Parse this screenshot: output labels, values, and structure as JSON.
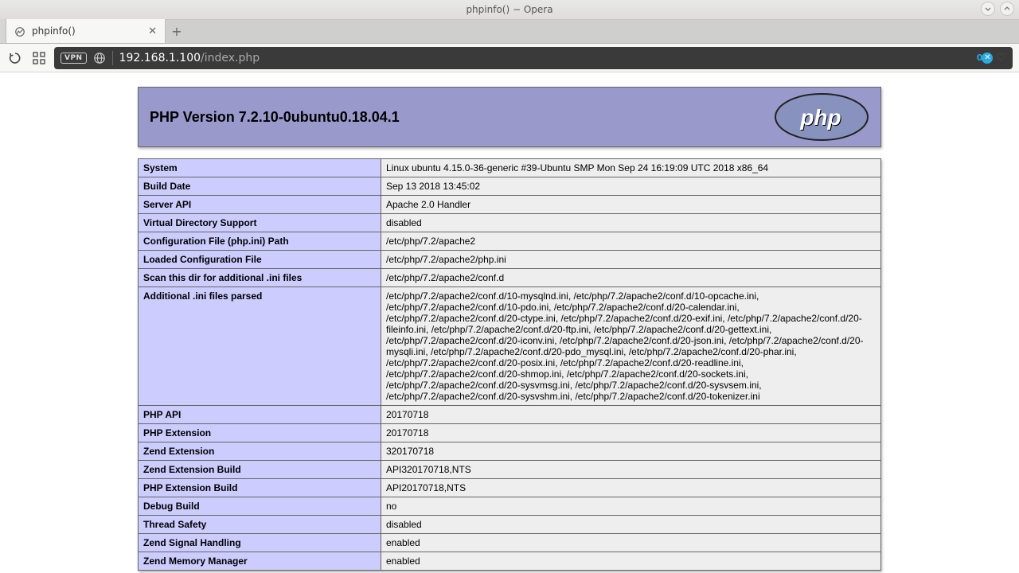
{
  "window": {
    "title": "phpinfo() − Opera"
  },
  "tab": {
    "label": "phpinfo()"
  },
  "address": {
    "vpn": "VPN",
    "host": "192.168.1.100",
    "path": "/index.php",
    "adblock_count": "0"
  },
  "php": {
    "header": "PHP Version 7.2.10-0ubuntu0.18.04.1"
  },
  "rows": [
    {
      "k": "System",
      "v": "Linux ubuntu 4.15.0-36-generic #39-Ubuntu SMP Mon Sep 24 16:19:09 UTC 2018 x86_64"
    },
    {
      "k": "Build Date",
      "v": "Sep 13 2018 13:45:02"
    },
    {
      "k": "Server API",
      "v": "Apache 2.0 Handler"
    },
    {
      "k": "Virtual Directory Support",
      "v": "disabled"
    },
    {
      "k": "Configuration File (php.ini) Path",
      "v": "/etc/php/7.2/apache2"
    },
    {
      "k": "Loaded Configuration File",
      "v": "/etc/php/7.2/apache2/php.ini"
    },
    {
      "k": "Scan this dir for additional .ini files",
      "v": "/etc/php/7.2/apache2/conf.d"
    },
    {
      "k": "Additional .ini files parsed",
      "v": "/etc/php/7.2/apache2/conf.d/10-mysqlnd.ini, /etc/php/7.2/apache2/conf.d/10-opcache.ini, /etc/php/7.2/apache2/conf.d/10-pdo.ini, /etc/php/7.2/apache2/conf.d/20-calendar.ini, /etc/php/7.2/apache2/conf.d/20-ctype.ini, /etc/php/7.2/apache2/conf.d/20-exif.ini, /etc/php/7.2/apache2/conf.d/20-fileinfo.ini, /etc/php/7.2/apache2/conf.d/20-ftp.ini, /etc/php/7.2/apache2/conf.d/20-gettext.ini, /etc/php/7.2/apache2/conf.d/20-iconv.ini, /etc/php/7.2/apache2/conf.d/20-json.ini, /etc/php/7.2/apache2/conf.d/20-mysqli.ini, /etc/php/7.2/apache2/conf.d/20-pdo_mysql.ini, /etc/php/7.2/apache2/conf.d/20-phar.ini, /etc/php/7.2/apache2/conf.d/20-posix.ini, /etc/php/7.2/apache2/conf.d/20-readline.ini, /etc/php/7.2/apache2/conf.d/20-shmop.ini, /etc/php/7.2/apache2/conf.d/20-sockets.ini, /etc/php/7.2/apache2/conf.d/20-sysvmsg.ini, /etc/php/7.2/apache2/conf.d/20-sysvsem.ini, /etc/php/7.2/apache2/conf.d/20-sysvshm.ini, /etc/php/7.2/apache2/conf.d/20-tokenizer.ini"
    },
    {
      "k": "PHP API",
      "v": "20170718"
    },
    {
      "k": "PHP Extension",
      "v": "20170718"
    },
    {
      "k": "Zend Extension",
      "v": "320170718"
    },
    {
      "k": "Zend Extension Build",
      "v": "API320170718,NTS"
    },
    {
      "k": "PHP Extension Build",
      "v": "API20170718,NTS"
    },
    {
      "k": "Debug Build",
      "v": "no"
    },
    {
      "k": "Thread Safety",
      "v": "disabled"
    },
    {
      "k": "Zend Signal Handling",
      "v": "enabled"
    },
    {
      "k": "Zend Memory Manager",
      "v": "enabled"
    }
  ]
}
